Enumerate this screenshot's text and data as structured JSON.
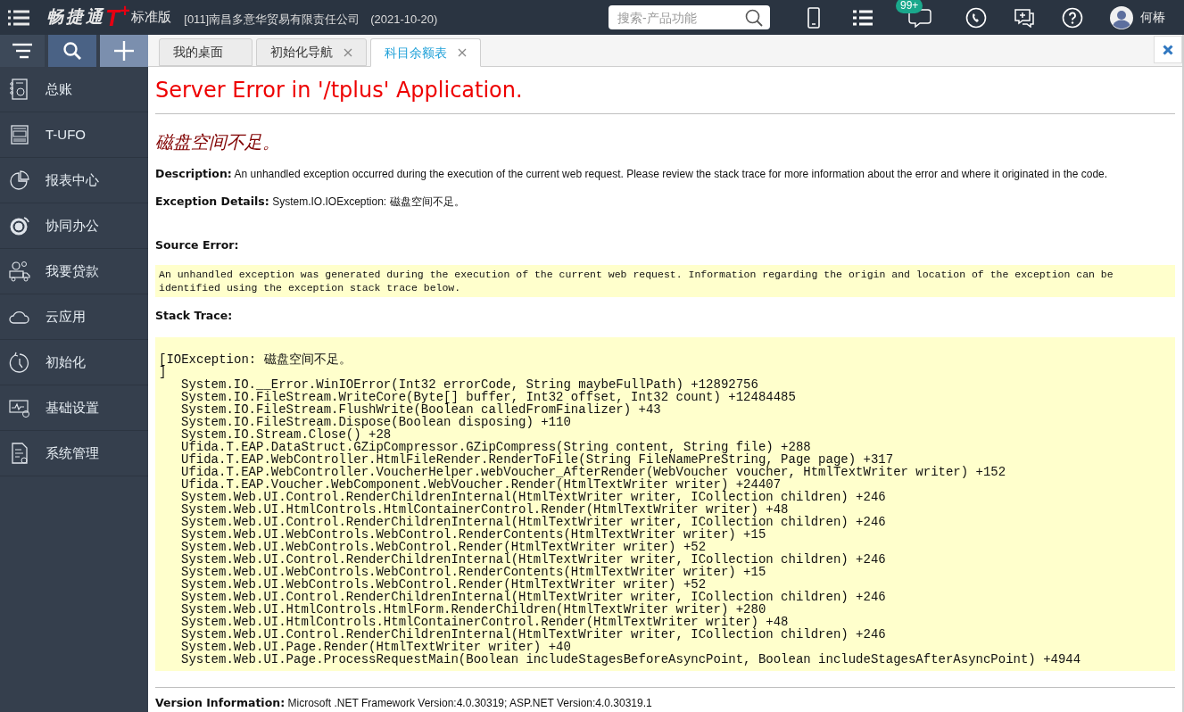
{
  "top_bar": {
    "brand": "畅捷通",
    "brand_mark": "T",
    "brand_sup": "+",
    "edition": "标准版",
    "company": "[011]南昌多意华贸易有限责任公司",
    "date": "(2021-10-20)",
    "search": {
      "placeholder": "搜索-产品功能"
    },
    "badge": "99+",
    "user": "何椿"
  },
  "sidebar": {
    "items": [
      {
        "label": "总账"
      },
      {
        "label": "T-UFO"
      },
      {
        "label": "报表中心"
      },
      {
        "label": "协同办公"
      },
      {
        "label": "我要贷款"
      },
      {
        "label": "云应用"
      },
      {
        "label": "初始化"
      },
      {
        "label": "基础设置"
      },
      {
        "label": "系统管理"
      }
    ]
  },
  "tabs": [
    {
      "label": "我的桌面",
      "selected": false,
      "closable": false
    },
    {
      "label": "初始化导航",
      "selected": false,
      "closable": true
    },
    {
      "label": "科目余额表",
      "selected": true,
      "closable": true
    }
  ],
  "page": {
    "title": "Server Error in '/tplus' Application.",
    "error_message": "磁盘空间不足。",
    "description_label": "Description:",
    "description": "An unhandled exception occurred during the execution of the current web request. Please review the stack trace for more information about the error and where it originated in the code.",
    "details_label": "Exception Details:",
    "details": "System.IO.IOException: 磁盘空间不足。",
    "source_error_label": "Source Error:",
    "source_error": "An unhandled exception was generated during the execution of the current web request. Information regarding the origin and location of the exception can be identified using the exception stack trace below.",
    "stack_trace_label": "Stack Trace:",
    "stack_header": [
      "[IOException: 磁盘空间不足。",
      "]"
    ],
    "stack_lines": [
      "System.IO.__Error.WinIOError(Int32 errorCode, String maybeFullPath) +12892756",
      "System.IO.FileStream.WriteCore(Byte[] buffer, Int32 offset, Int32 count) +12484485",
      "System.IO.FileStream.FlushWrite(Boolean calledFromFinalizer) +43",
      "System.IO.FileStream.Dispose(Boolean disposing) +110",
      "System.IO.Stream.Close() +28",
      "Ufida.T.EAP.DataStruct.GZipCompressor.GZipCompress(String content, String file) +288",
      "Ufida.T.EAP.WebController.HtmlFileRender.RenderToFile(String FileNamePreString, Page page) +317",
      "Ufida.T.EAP.WebController.VoucherHelper.webVoucher_AfterRender(WebVoucher voucher, HtmlTextWriter writer) +152",
      "Ufida.T.EAP.Voucher.WebComponent.WebVoucher.Render(HtmlTextWriter writer) +24407",
      "System.Web.UI.Control.RenderChildrenInternal(HtmlTextWriter writer, ICollection children) +246",
      "System.Web.UI.HtmlControls.HtmlContainerControl.Render(HtmlTextWriter writer) +48",
      "System.Web.UI.Control.RenderChildrenInternal(HtmlTextWriter writer, ICollection children) +246",
      "System.Web.UI.WebControls.WebControl.RenderContents(HtmlTextWriter writer) +15",
      "System.Web.UI.WebControls.WebControl.Render(HtmlTextWriter writer) +52",
      "System.Web.UI.Control.RenderChildrenInternal(HtmlTextWriter writer, ICollection children) +246",
      "System.Web.UI.WebControls.WebControl.RenderContents(HtmlTextWriter writer) +15",
      "System.Web.UI.WebControls.WebControl.Render(HtmlTextWriter writer) +52",
      "System.Web.UI.Control.RenderChildrenInternal(HtmlTextWriter writer, ICollection children) +246",
      "System.Web.UI.HtmlControls.HtmlForm.RenderChildren(HtmlTextWriter writer) +280",
      "System.Web.UI.HtmlControls.HtmlContainerControl.Render(HtmlTextWriter writer) +48",
      "System.Web.UI.Control.RenderChildrenInternal(HtmlTextWriter writer, ICollection children) +246",
      "System.Web.UI.Page.Render(HtmlTextWriter writer) +40",
      "System.Web.UI.Page.ProcessRequestMain(Boolean includeStagesBeforeAsyncPoint, Boolean includeStagesAfterAsyncPoint) +4944"
    ],
    "version_label": "Version Information:",
    "version": "Microsoft .NET Framework Version:4.0.30319; ASP.NET Version:4.0.30319.1"
  }
}
